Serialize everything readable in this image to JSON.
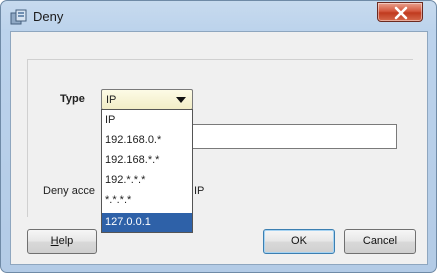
{
  "window": {
    "title": "Deny",
    "close_symbol": "x"
  },
  "form": {
    "type_label": "Type",
    "type_selected": "IP",
    "text_value": "",
    "deny_label": "Deny acce",
    "deny_label_tail": "IP"
  },
  "dropdown": {
    "options": [
      "IP",
      "192.168.0.*",
      "192.168.*.*",
      "192.*.*.*",
      "*.*.*.*",
      "127.0.0.1"
    ],
    "selected_index": 5
  },
  "buttons": {
    "help_first": "H",
    "help_rest": "elp",
    "ok": "OK",
    "cancel": "Cancel"
  },
  "colors": {
    "selection": "#2e61a8",
    "title_bar": "#bcd3ec",
    "close_button": "#c03a1f"
  }
}
